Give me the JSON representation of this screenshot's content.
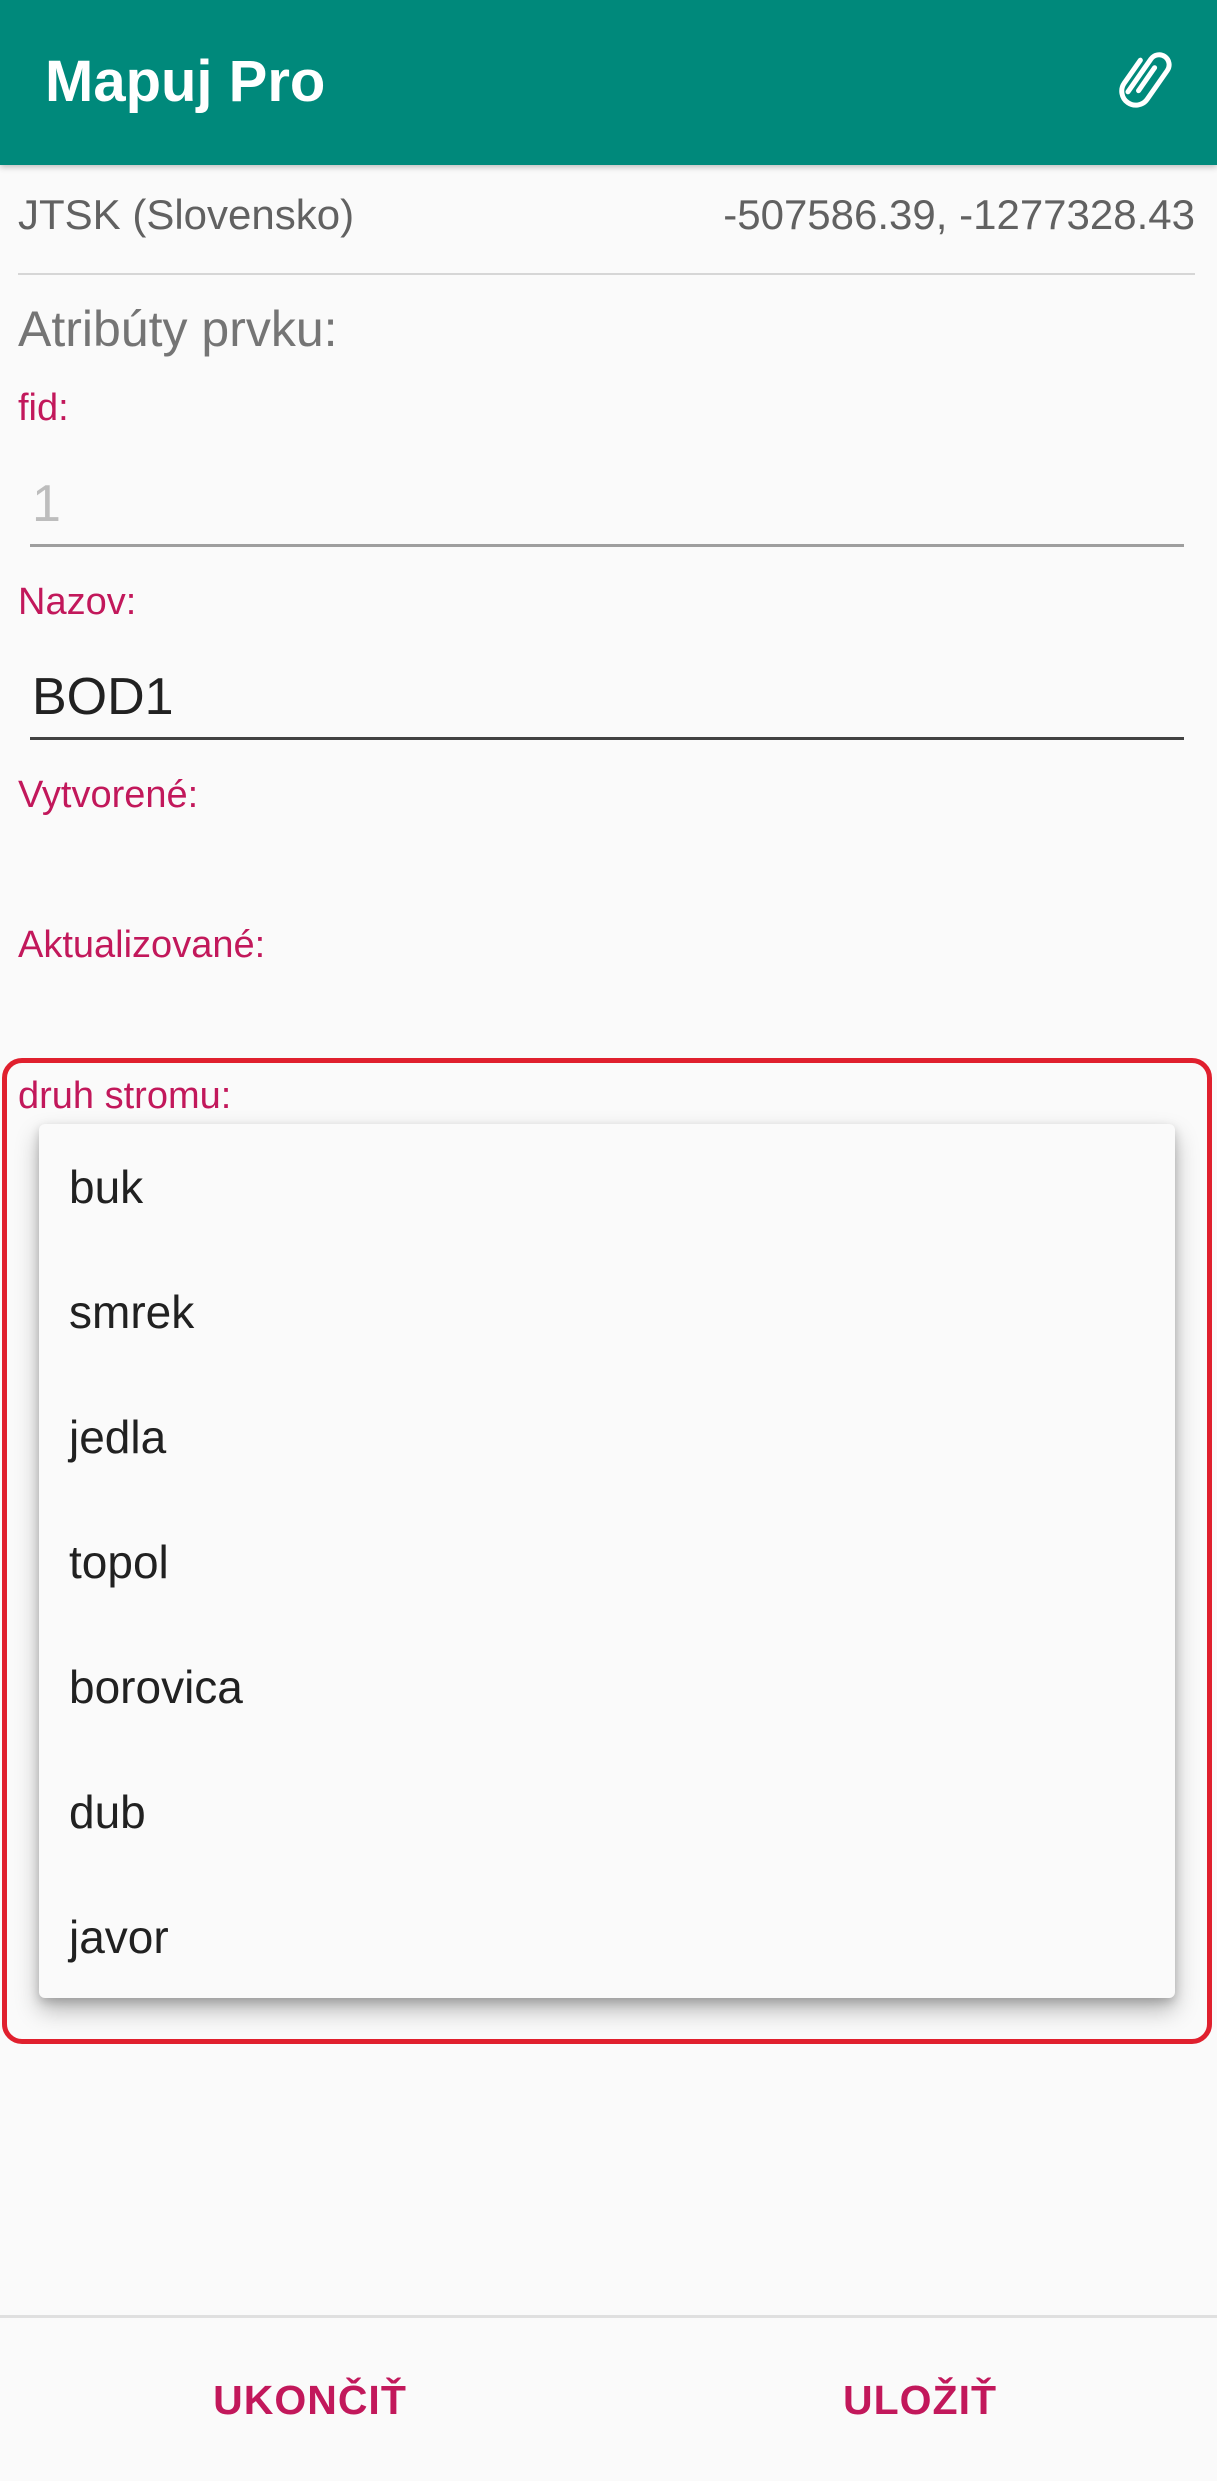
{
  "app": {
    "title": "Mapuj Pro"
  },
  "toolbar": {
    "attach_icon": "paperclip-icon"
  },
  "location": {
    "crs": "JTSK (Slovensko)",
    "coordinates": "-507586.39, -1277328.43"
  },
  "attributes": {
    "section_title": "Atribúty prvku:",
    "fid": {
      "label": "fid:",
      "value": "1"
    },
    "nazov": {
      "label": "Nazov:",
      "value": "BOD1"
    },
    "vytvorene": {
      "label": "Vytvorené:"
    },
    "aktualizovane": {
      "label": "Aktualizované:"
    },
    "druh_stromu": {
      "label": "druh stromu:",
      "options": [
        "buk",
        "smrek",
        "jedla",
        "topol",
        "borovica",
        "dub",
        "javor"
      ]
    }
  },
  "actions": {
    "cancel": "UKONČIŤ",
    "save": "ULOŽIŤ"
  },
  "colors": {
    "appbar": "#00897b",
    "accent": "#c2185b",
    "highlight": "#e0202e"
  }
}
